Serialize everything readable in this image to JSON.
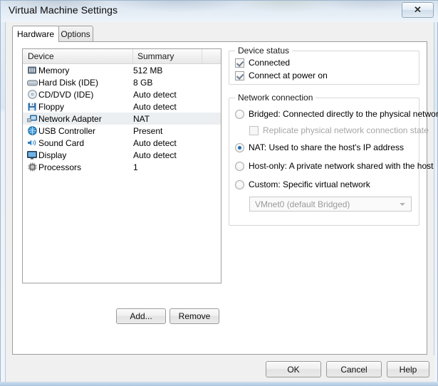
{
  "window": {
    "title": "Virtual Machine Settings",
    "close_label": "✕",
    "close_icon": "close-icon"
  },
  "tabs": [
    {
      "label": "Hardware",
      "active": true
    },
    {
      "label": "Options",
      "active": false
    }
  ],
  "device_list": {
    "columns": [
      "Device",
      "Summary",
      ""
    ],
    "rows": [
      {
        "name": "Memory",
        "summary": "512 MB",
        "icon": "memory-icon",
        "selected": false
      },
      {
        "name": "Hard Disk (IDE)",
        "summary": "8 GB",
        "icon": "harddisk-icon",
        "selected": false
      },
      {
        "name": "CD/DVD (IDE)",
        "summary": "Auto detect",
        "icon": "cddvd-icon",
        "selected": false
      },
      {
        "name": "Floppy",
        "summary": "Auto detect",
        "icon": "floppy-icon",
        "selected": false
      },
      {
        "name": "Network Adapter",
        "summary": "NAT",
        "icon": "network-icon",
        "selected": true
      },
      {
        "name": "USB Controller",
        "summary": "Present",
        "icon": "usb-icon",
        "selected": false
      },
      {
        "name": "Sound Card",
        "summary": "Auto detect",
        "icon": "sound-icon",
        "selected": false
      },
      {
        "name": "Display",
        "summary": "Auto detect",
        "icon": "display-icon",
        "selected": false
      },
      {
        "name": "Processors",
        "summary": "1",
        "icon": "cpu-icon",
        "selected": false
      }
    ]
  },
  "list_buttons": {
    "add": "Add...",
    "remove": "Remove"
  },
  "device_status": {
    "title": "Device status",
    "connected": {
      "label": "Connected",
      "checked": true,
      "disabled": false
    },
    "connect_at_power_on": {
      "label": "Connect at power on",
      "checked": true,
      "disabled": false
    }
  },
  "network_connection": {
    "title": "Network connection",
    "options": [
      {
        "label": "Bridged: Connected directly to the physical network",
        "selected": false
      },
      {
        "label": "NAT: Used to share the host's IP address",
        "selected": true
      },
      {
        "label": "Host-only: A private network shared with the host",
        "selected": false
      },
      {
        "label": "Custom: Specific virtual network",
        "selected": false
      }
    ],
    "replicate": {
      "label": "Replicate physical network connection state",
      "checked": false,
      "disabled": true
    },
    "vmnet_select": {
      "value": "VMnet0 (default Bridged)",
      "disabled": true
    }
  },
  "dialog_buttons": {
    "ok": "OK",
    "cancel": "Cancel",
    "help": "Help"
  },
  "colors": {
    "accent": "#1a6fb5",
    "window_bg": "#f0f0f0",
    "panel_bg": "#ffffff",
    "selection": "#eceff1"
  }
}
